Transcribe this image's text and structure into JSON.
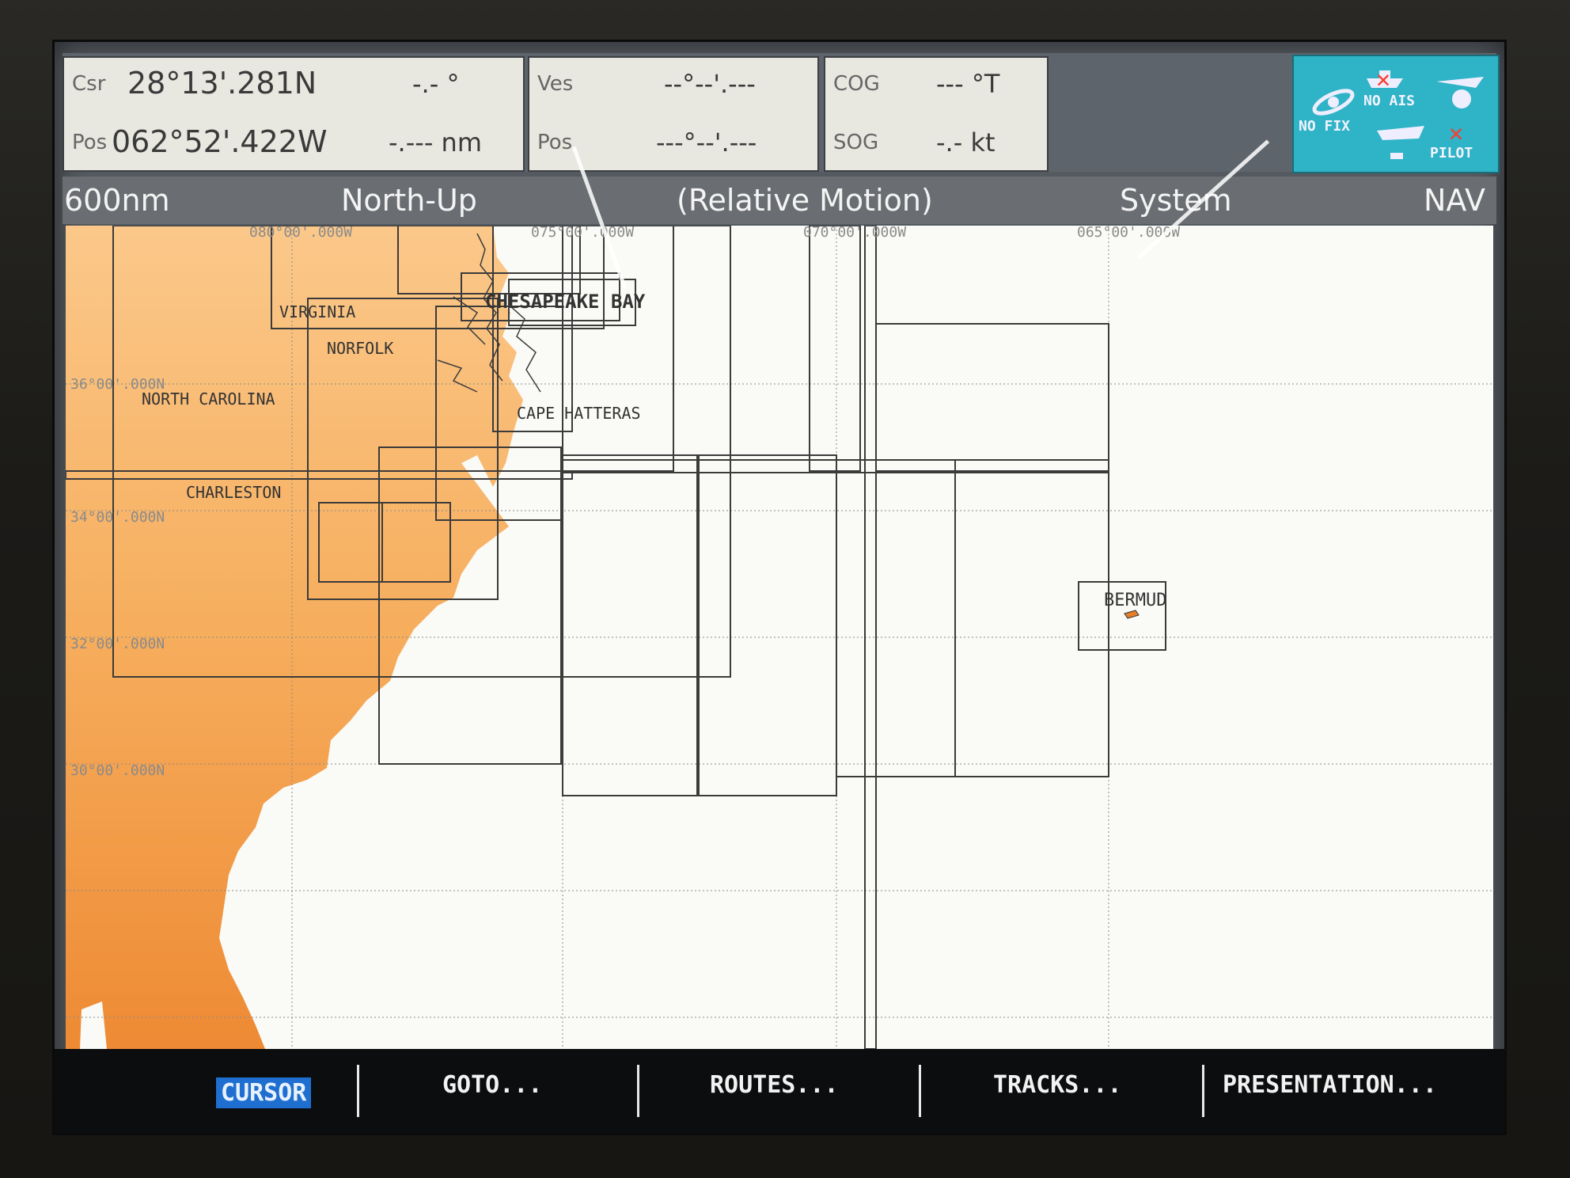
{
  "databar": {
    "csr_label": "Csr",
    "csr_lat": "28°13'.281N",
    "csr_bearing": "-.- °",
    "pos_label": "Pos",
    "pos_lon": "062°52'.422W",
    "pos_range": "-.--- nm",
    "ves_label": "Ves",
    "ves_lat": "--°--'.---",
    "vpos_label": "Pos",
    "vpos_lon": "---°--'.---",
    "cog_label": "COG",
    "cog_value": "--- °T",
    "sog_label": "SOG",
    "sog_value": "-.- kt"
  },
  "status": {
    "nofix": "NO FIX",
    "noais": "NO AIS",
    "pilot": "PILOT"
  },
  "titlebar": {
    "range": "600nm",
    "orientation": "North-Up",
    "motion": "(Relative Motion)",
    "mode": "System",
    "nav": "NAV"
  },
  "chart": {
    "lon_labels": [
      "080°00'.000W",
      "075°00'.000W",
      "070°00'.000W",
      "065°00'.000W"
    ],
    "lat_labels": [
      "36°00'.000N",
      "34°00'.000N",
      "32°00'.000N",
      "30°00'.000N"
    ],
    "places": {
      "virginia": "VIRGINIA",
      "norfolk": "NORFOLK",
      "north_carolina": "NORTH CAROLINA",
      "chesapeake": "CHESAPEAKE BAY",
      "cape_hatteras": "CAPE HATTERAS",
      "charleston": "CHARLESTON",
      "bermuda": "BERMUD"
    },
    "colors": {
      "land": "#f29a3e",
      "sea": "#fafaf6",
      "chart_lines": "#3b3b3b"
    }
  },
  "softkeys": [
    {
      "label": "CURSOR",
      "active": true
    },
    {
      "label": "GOTO..."
    },
    {
      "label": "ROUTES..."
    },
    {
      "label": "TRACKS..."
    },
    {
      "label": "PRESENTATION..."
    }
  ]
}
